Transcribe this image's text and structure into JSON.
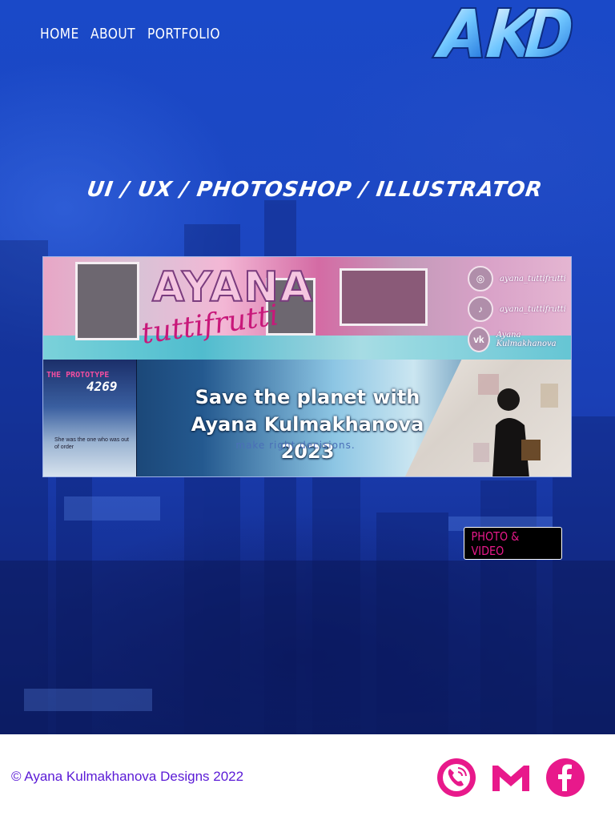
{
  "nav": {
    "items": [
      {
        "label": "HOME"
      },
      {
        "label": "ABOUT"
      },
      {
        "label": "PORTFOLIO"
      }
    ]
  },
  "logo": {
    "text": "AKD",
    "icon": "akd-logo"
  },
  "hero": {
    "tagline": "UI / UX / PHOTOSHOP / ILLUSTRATOR"
  },
  "gallery": {
    "top_banner": {
      "title": "AYANA",
      "subtitle": "tuttifrutti",
      "social": [
        {
          "icon": "instagram-icon",
          "glyph": "◎",
          "handle": "ayana_tuttifrutti"
        },
        {
          "icon": "tiktok-icon",
          "glyph": "♪",
          "handle": "ayana_tuttifrutti"
        },
        {
          "icon": "vk-icon",
          "glyph": "vk",
          "handle": "Ayana Kulmakhanova"
        }
      ]
    },
    "bottom_banner": {
      "poster_title": "THE PROTOTYPE",
      "poster_number": "4269",
      "poster_caption": "She was the one who was out of order",
      "headline_line1": "Save the planet with",
      "headline_line2": "Ayana Kulmakhanova 2023",
      "subline": "make right decisions."
    }
  },
  "button": {
    "label": "PHOTO & VIDEO"
  },
  "footer": {
    "copyright": "© Ayana Kulmakhanova Designs 2022",
    "icons": [
      {
        "name": "phone-icon"
      },
      {
        "name": "gmail-icon"
      },
      {
        "name": "facebook-icon"
      }
    ]
  },
  "colors": {
    "hero_blue": "#1c47c2",
    "accent_pink": "#e8198b",
    "footer_text": "#5a1ad6",
    "button_bg": "#000000"
  }
}
